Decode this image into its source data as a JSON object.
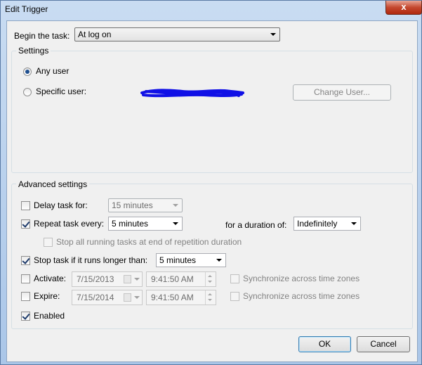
{
  "window": {
    "title": "Edit Trigger",
    "close_glyph": "x"
  },
  "begin": {
    "label": "Begin the task:",
    "value": "At log on"
  },
  "settings": {
    "group_label": "Settings",
    "any_user": "Any user",
    "specific_user": "Specific user:",
    "selected": "any_user",
    "change_user_button": "Change User..."
  },
  "advanced": {
    "group_label": "Advanced settings",
    "delay": {
      "label": "Delay task for:",
      "checked": false,
      "value": "15 minutes"
    },
    "repeat": {
      "label": "Repeat task every:",
      "checked": true,
      "value": "5 minutes",
      "duration_label": "for a duration of:",
      "duration_value": "Indefinitely",
      "stop_all_label": "Stop all running tasks at end of repetition duration"
    },
    "stop": {
      "label": "Stop task if it runs longer than:",
      "checked": true,
      "value": "5 minutes"
    },
    "activate": {
      "label": "Activate:",
      "checked": false,
      "date": "7/15/2013",
      "time": "9:41:50 AM",
      "sync_label": "Synchronize across time zones"
    },
    "expire": {
      "label": "Expire:",
      "checked": false,
      "date": "7/15/2014",
      "time": "9:41:50 AM",
      "sync_label": "Synchronize across time zones"
    },
    "enabled": {
      "label": "Enabled",
      "checked": true
    }
  },
  "buttons": {
    "ok": "OK",
    "cancel": "Cancel"
  },
  "colors": {
    "redaction": "#1010e6",
    "close": "#c4482f"
  }
}
